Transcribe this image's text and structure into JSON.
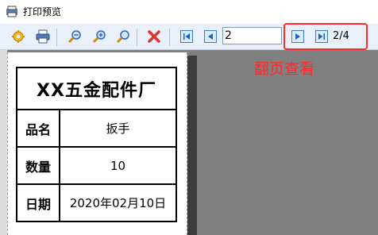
{
  "window": {
    "title": "打印预览"
  },
  "toolbar": {
    "page_input_value": "2",
    "page_count": "2/4",
    "buttons": [
      {
        "name": "settings",
        "icon": "gear-icon"
      },
      {
        "name": "print",
        "icon": "printer-icon"
      },
      {
        "name": "zoom-out",
        "icon": "zoom-out-icon"
      },
      {
        "name": "zoom-in",
        "icon": "zoom-in-icon"
      },
      {
        "name": "zoom-fit",
        "icon": "zoom-icon"
      },
      {
        "name": "close",
        "icon": "close-icon"
      },
      {
        "name": "first-page",
        "icon": "first-page-icon"
      },
      {
        "name": "prev-page",
        "icon": "prev-page-icon"
      },
      {
        "name": "next-page",
        "icon": "next-page-icon"
      },
      {
        "name": "last-page",
        "icon": "last-page-icon"
      }
    ]
  },
  "annotation": {
    "text": "翻页查看",
    "color": "#ff2a2a"
  },
  "card": {
    "company": "XX五金配件厂",
    "rows": [
      {
        "label": "品名",
        "value": "扳手"
      },
      {
        "label": "数量",
        "value": "10"
      },
      {
        "label": "日期",
        "value": "2020年02月10日"
      }
    ]
  }
}
